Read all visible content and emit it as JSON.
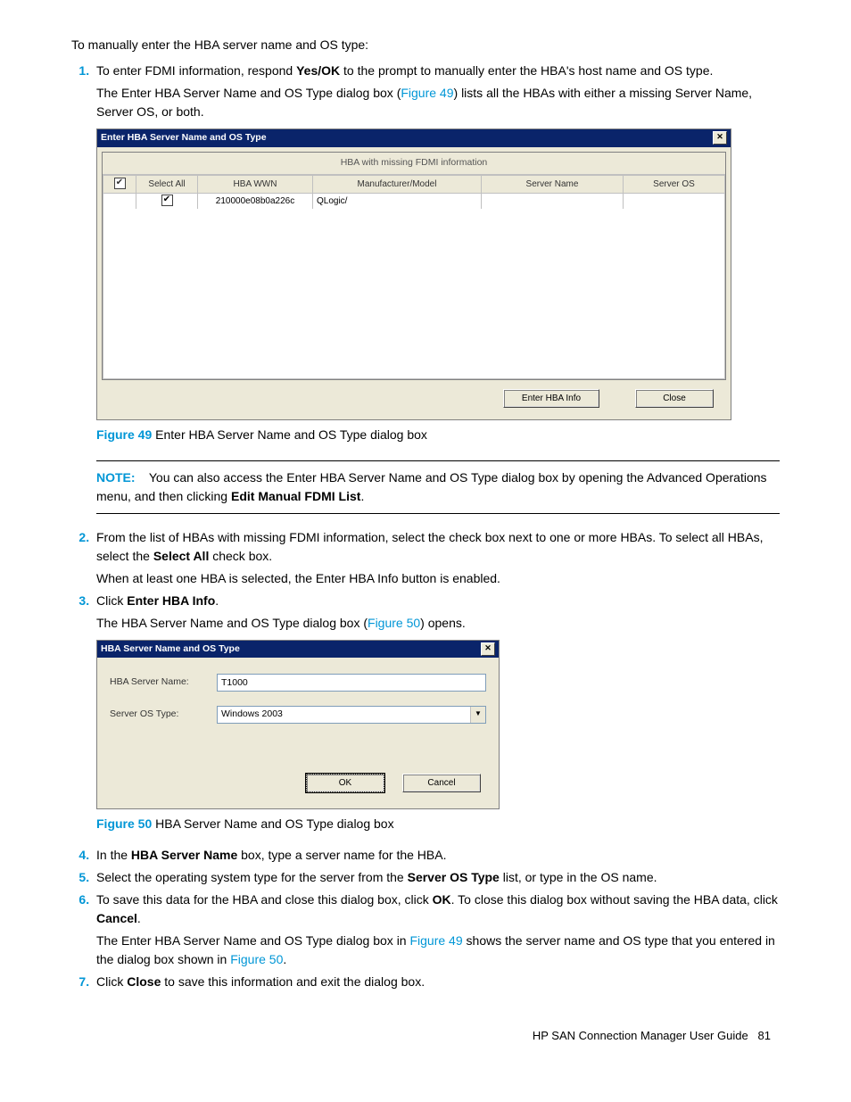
{
  "intro": "To manually enter the HBA server name and OS type:",
  "steps": {
    "s1a": "To enter FDMI information, respond ",
    "s1b": "Yes/OK",
    "s1c": " to the prompt to manually enter the HBA's host name and OS type.",
    "s1d": "The Enter HBA Server Name and OS Type dialog box (",
    "s1e": "Figure 49",
    "s1f": ") lists all the HBAs with either a missing Server Name, Server OS, or both.",
    "s2a": "From the list of HBAs with missing FDMI information, select the check box next to one or more HBAs. To select all HBAs, select the ",
    "s2b": "Select All",
    "s2c": " check box.",
    "s2d": "When at least one HBA is selected, the Enter HBA Info button is enabled.",
    "s3a": "Click ",
    "s3b": "Enter HBA Info",
    "s3c": ".",
    "s3d": "The HBA Server Name and OS Type dialog box (",
    "s3e": "Figure 50",
    "s3f": ") opens.",
    "s4a": "In the ",
    "s4b": "HBA Server Name",
    "s4c": " box, type a server name for the HBA.",
    "s5a": "Select the operating system type for the server from the ",
    "s5b": "Server OS Type",
    "s5c": " list, or type in the OS name.",
    "s6a": "To save this data for the HBA and close this dialog box, click ",
    "s6b": "OK",
    "s6c": ". To close this dialog box without saving the HBA data, click ",
    "s6d": "Cancel",
    "s6e": ".",
    "s6f": "The Enter HBA Server Name and OS Type dialog box in ",
    "s6g": "Figure 49",
    "s6h": " shows the server name and OS type that you entered in the dialog box shown in ",
    "s6i": "Figure 50",
    "s6j": ".",
    "s7a": "Click ",
    "s7b": "Close",
    "s7c": " to save this information and exit the dialog box."
  },
  "fig49": {
    "title": "Enter HBA Server Name and OS Type",
    "subtitle": "HBA with missing FDMI information",
    "headers": {
      "h1": "Select All",
      "h2": "HBA WWN",
      "h3": "Manufacturer/Model",
      "h4": "Server Name",
      "h5": "Server OS"
    },
    "row": {
      "wwn": "210000e08b0a226c",
      "mfg": "QLogic/"
    },
    "btn_enter": "Enter HBA Info",
    "btn_close": "Close",
    "caption_num": "Figure 49",
    "caption_text": " Enter HBA Server Name and OS Type dialog box"
  },
  "note": {
    "label": "NOTE:",
    "text1": "You can also access the Enter HBA Server Name and OS Type dialog box by opening the Advanced Operations menu, and then clicking ",
    "text2": "Edit Manual FDMI List",
    "text3": "."
  },
  "fig50": {
    "title": "HBA Server Name and OS Type",
    "label1": "HBA Server Name:",
    "value1": "T1000",
    "label2": "Server OS Type:",
    "value2": "Windows 2003",
    "btn_ok": "OK",
    "btn_cancel": "Cancel",
    "caption_num": "Figure 50",
    "caption_text": " HBA Server Name and OS Type dialog box"
  },
  "footer": {
    "text": "HP SAN Connection Manager User Guide",
    "page": "81"
  }
}
